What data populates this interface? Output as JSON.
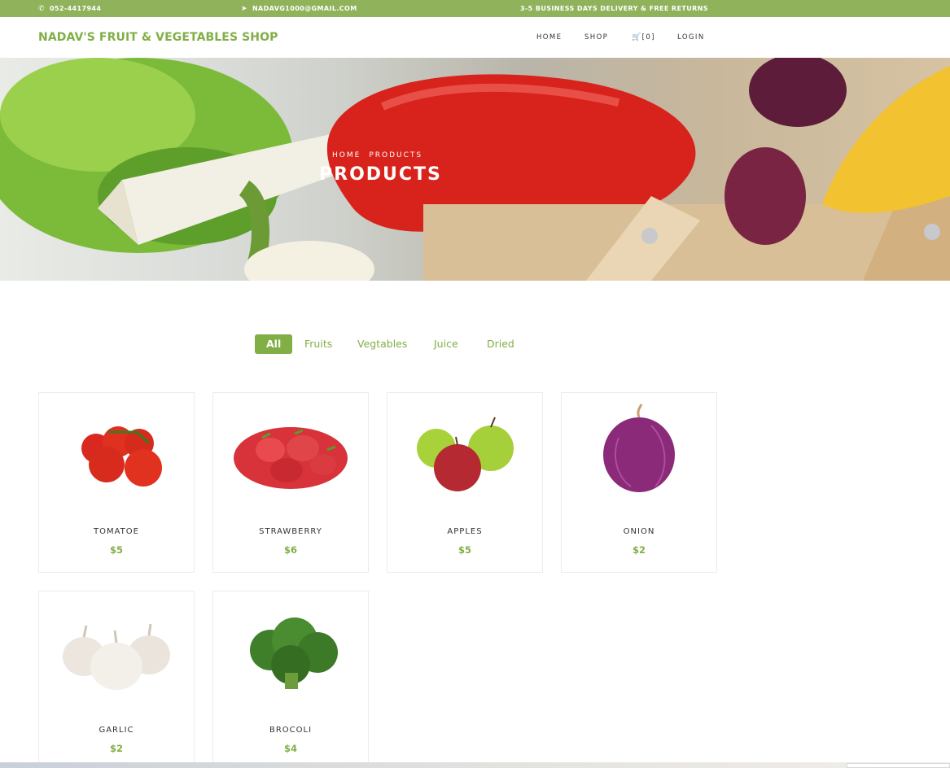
{
  "topbar": {
    "phone": "052-4417944",
    "email": "NADAVG1000@GMAIL.COM",
    "notice": "3-5 BUSINESS DAYS DELIVERY & FREE RETURNS",
    "phone_icon": "phone-icon",
    "email_icon": "paper-plane-icon"
  },
  "navbar": {
    "brand": "NADAV'S FRUIT & VEGETABLES SHOP",
    "home": "HOME",
    "shop": "SHOP",
    "cart": "[0]",
    "cart_icon": "cart-icon",
    "login": "LOGIN"
  },
  "hero": {
    "breadcrumb_home": "HOME",
    "breadcrumb_products": "PRODUCTS",
    "title": "PRODUCTS"
  },
  "filters": {
    "all": "All",
    "fruits": "Fruits",
    "vegetables": "Vegtables",
    "juice": "Juice",
    "dried": "Dried"
  },
  "products": [
    {
      "name": "TOMATOE",
      "price": "$5"
    },
    {
      "name": "STRAWBERRY",
      "price": "$6"
    },
    {
      "name": "APPLES",
      "price": "$5"
    },
    {
      "name": "ONION",
      "price": "$2"
    },
    {
      "name": "GARLIC",
      "price": "$2"
    },
    {
      "name": "BROCOLI",
      "price": "$4"
    }
  ],
  "colors": {
    "accent": "#82ae46",
    "topbar": "#8fb25a"
  }
}
